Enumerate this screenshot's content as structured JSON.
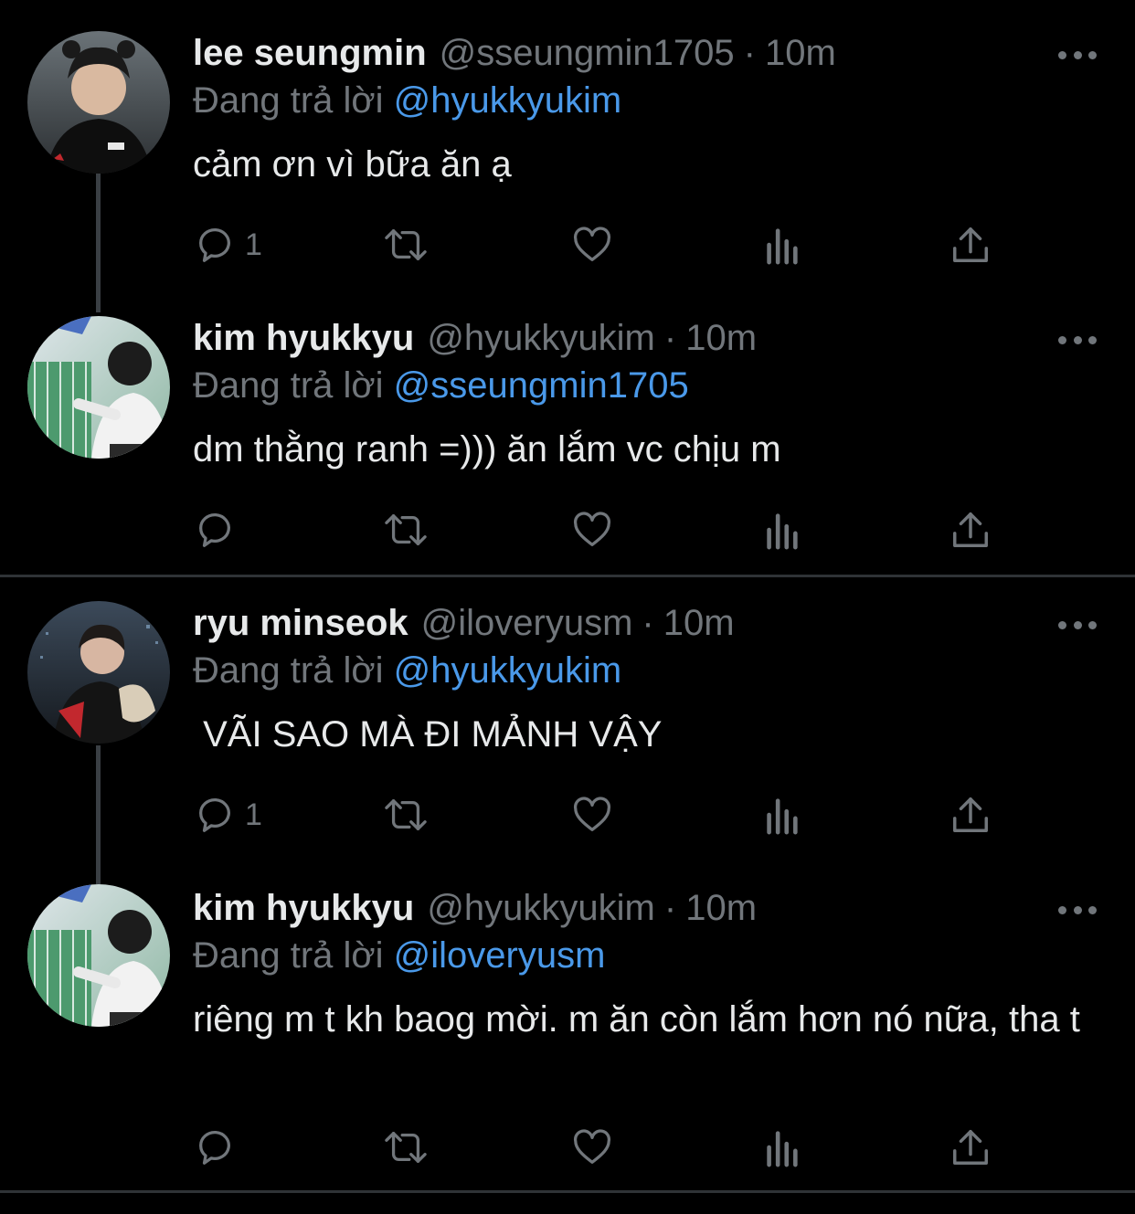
{
  "reply_prefix": "Đang trả lời",
  "tweets": [
    {
      "name": "lee seungmin",
      "handle": "@sseungmin1705",
      "separator": "·",
      "time": "10m",
      "replying_to": "@hyukkyukim",
      "text": "cảm ơn vì bữa ăn ạ",
      "reply_count": "1",
      "avatar": "avatar-lee-seungmin"
    },
    {
      "name": "kim hyukkyu",
      "handle": "@hyukkyukim",
      "separator": "·",
      "time": "10m",
      "replying_to": "@sseungmin1705",
      "text": "dm thằng ranh =))) ăn lắm vc chịu m",
      "reply_count": "",
      "avatar": "avatar-kim-hyukkyu"
    },
    {
      "name": "ryu minseok",
      "handle": "@iloveryusm",
      "separator": "·",
      "time": "10m",
      "replying_to": "@hyukkyukim",
      "text": " VÃI SAO MÀ ĐI MẢNH VẬY",
      "reply_count": "1",
      "avatar": "avatar-ryu-minseok"
    },
    {
      "name": "kim hyukkyu",
      "handle": "@hyukkyukim",
      "separator": "·",
      "time": "10m",
      "replying_to": "@iloveryusm",
      "text": "riêng m t kh baog mời. m ăn còn lắm hơn nó nữa, tha t",
      "reply_count": "",
      "avatar": "avatar-kim-hyukkyu"
    }
  ],
  "icons": {
    "reply": "reply-icon",
    "retweet": "retweet-icon",
    "like": "heart-icon",
    "views": "views-icon",
    "share": "share-icon",
    "more": "more-icon"
  },
  "colors": {
    "background": "#000000",
    "text": "#e7e9ea",
    "muted": "#71767b",
    "mention": "#4a99e9",
    "divider": "#2f3336"
  }
}
